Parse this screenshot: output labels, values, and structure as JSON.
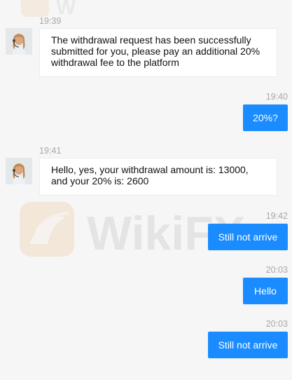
{
  "messages": [
    {
      "time": "19:39",
      "text": "The withdrawal request has been successfully submitted for you, please pay an additional 20% withdrawal fee to the platform"
    },
    {
      "time": "19:40",
      "text": "20%?"
    },
    {
      "time": "19:41",
      "text": "Hello, yes, your withdrawal amount is: 13000, and your 20% is: 2600"
    },
    {
      "time": "19:42",
      "text": "Still not arrive"
    },
    {
      "time": "20:03",
      "text": "Hello"
    },
    {
      "time": "20:03",
      "text": "Still not arrive"
    }
  ],
  "watermark": {
    "text": "WikiFX",
    "icon": "wikifx-logo-icon"
  },
  "colors": {
    "outgoing_bubble": "#1a8cff",
    "incoming_bubble": "#ffffff",
    "background": "#f6f6f6",
    "timestamp": "#a8a8a8"
  }
}
